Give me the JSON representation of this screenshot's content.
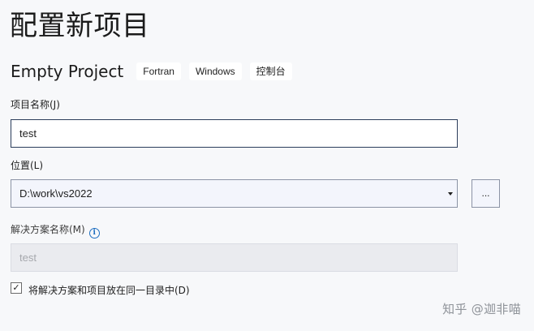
{
  "header": {
    "title": "配置新项目"
  },
  "project": {
    "name": "Empty Project",
    "tags": [
      "Fortran",
      "Windows",
      "控制台"
    ]
  },
  "fields": {
    "project_name": {
      "label": "项目名称(J)",
      "value": "test"
    },
    "location": {
      "label": "位置(L)",
      "value": "D:\\work\\vs2022",
      "browse_label": "..."
    },
    "solution_name": {
      "label": "解决方案名称(M)",
      "value": "test"
    }
  },
  "options": {
    "same_directory": {
      "label": "将解决方案和项目放在同一目录中(D)",
      "checked": true,
      "mark": "✓"
    }
  },
  "icons": {
    "info": "i"
  },
  "watermark": "知乎 @迦非喵",
  "colors": {
    "background": "#f7f8fa",
    "active_border": "#2b3d5b",
    "info_blue": "#1f6fc0"
  }
}
